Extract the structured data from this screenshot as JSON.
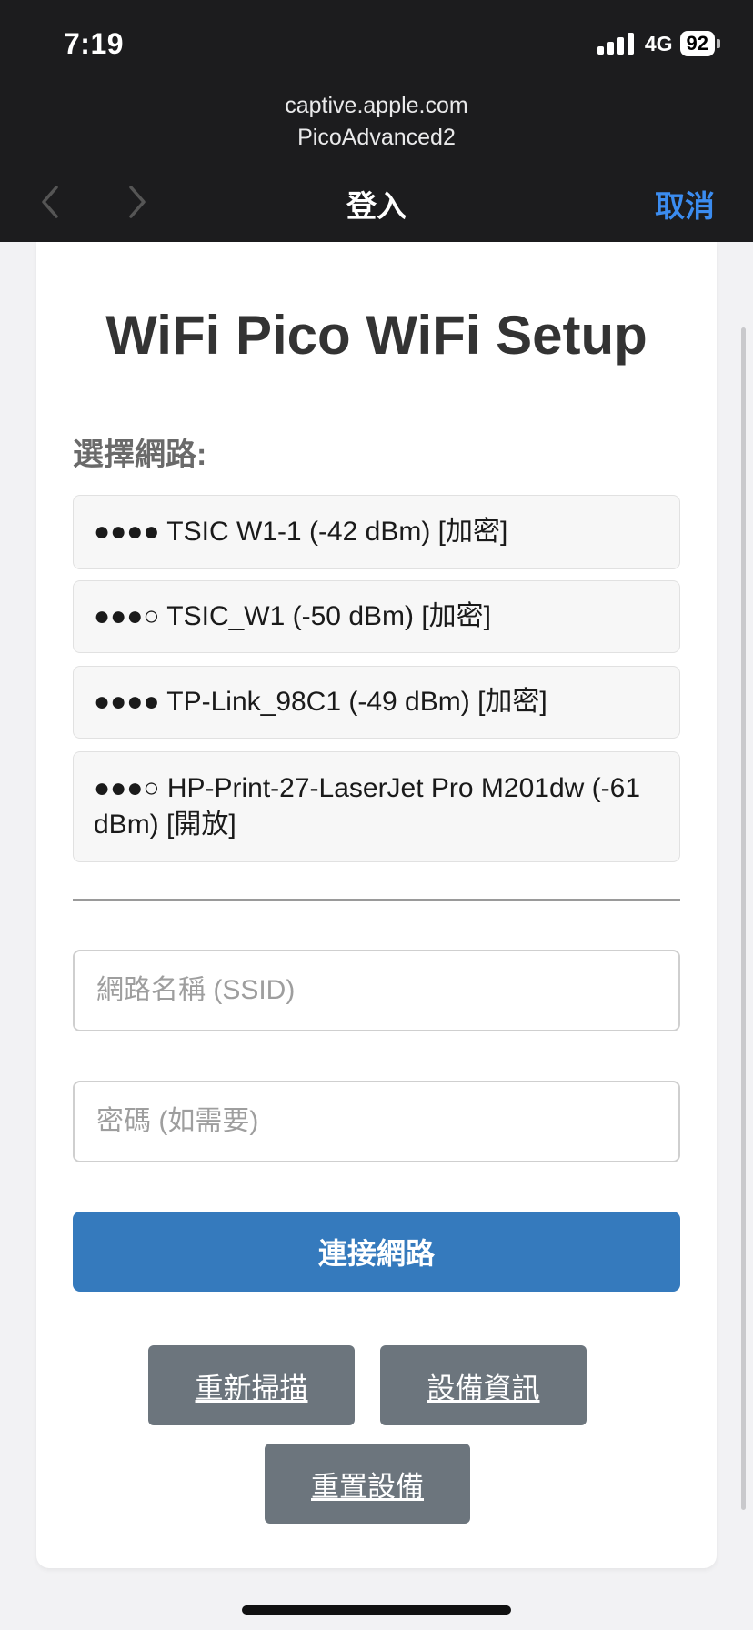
{
  "status_bar": {
    "time": "7:19",
    "network": "4G",
    "battery": "92"
  },
  "browser": {
    "domain": "captive.apple.com",
    "page_name": "PicoAdvanced2",
    "title": "登入",
    "cancel_label": "取消",
    "accent_color": "#3b8cf0"
  },
  "page": {
    "title": "WiFi Pico WiFi Setup",
    "select_label": "選擇網路:",
    "networks": [
      {
        "label": "●●●● TSIC W1-1 (-42 dBm) [加密]"
      },
      {
        "label": "●●●○ TSIC_W1 (-50 dBm) [加密]"
      },
      {
        "label": "●●●● TP-Link_98C1 (-49 dBm) [加密]"
      },
      {
        "label": "●●●○ HP-Print-27-LaserJet Pro M201dw (-61 dBm) [開放]"
      }
    ],
    "ssid_placeholder": "網路名稱 (SSID)",
    "password_placeholder": "密碼 (如需要)",
    "connect_label": "連接網路",
    "connect_color": "#357abd",
    "rescan_label": "重新掃描",
    "device_info_label": "設備資訊",
    "reset_label": "重置設備",
    "secondary_button_color": "#6c757d"
  }
}
